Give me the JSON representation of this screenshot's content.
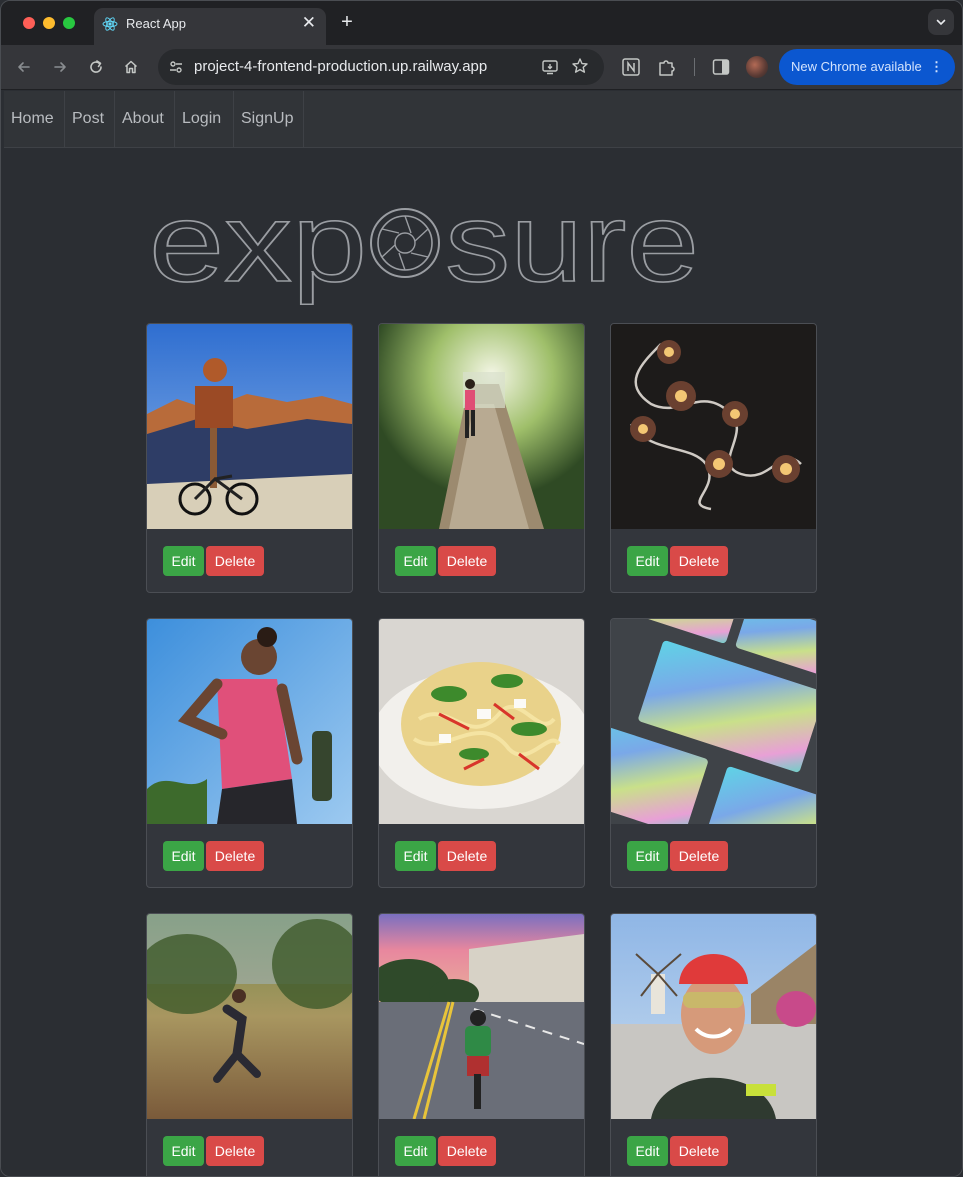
{
  "browser": {
    "tab_title": "React App",
    "tab_close": "✕",
    "new_tab": "+",
    "url": "project-4-frontend-production.up.railway.app",
    "update_button": "New Chrome available",
    "update_menu": "⋮"
  },
  "nav": {
    "items": [
      "Home",
      "Post",
      "About",
      "Login",
      "SignUp"
    ]
  },
  "logo": {
    "left_text": "exp",
    "right_text": "sure"
  },
  "cards": [
    {
      "edit": "Edit",
      "delete": "Delete",
      "image": "cycling-bike-mountain-sign-photo"
    },
    {
      "edit": "Edit",
      "delete": "Delete",
      "image": "runner-forest-path-tunnel-photo"
    },
    {
      "edit": "Edit",
      "delete": "Delete",
      "image": "flower-lamps-cable-photo"
    },
    {
      "edit": "Edit",
      "delete": "Delete",
      "image": "athlete-water-bottle-photo"
    },
    {
      "edit": "Edit",
      "delete": "Delete",
      "image": "pasta-salad-photo"
    },
    {
      "edit": "Edit",
      "delete": "Delete",
      "image": "holographic-cards-photo"
    },
    {
      "edit": "Edit",
      "delete": "Delete",
      "image": "runner-motion-blur-park-photo"
    },
    {
      "edit": "Edit",
      "delete": "Delete",
      "image": "cyclist-road-sunset-photo"
    },
    {
      "edit": "Edit",
      "delete": "Delete",
      "image": "cyclist-selfie-windmill-photo"
    }
  ],
  "colors": {
    "edit_button": "#3ba546",
    "delete_button": "#d94a48",
    "page_background": "#2b2e33",
    "card_background": "#33363c",
    "logo_stroke": "#9a9da2"
  }
}
